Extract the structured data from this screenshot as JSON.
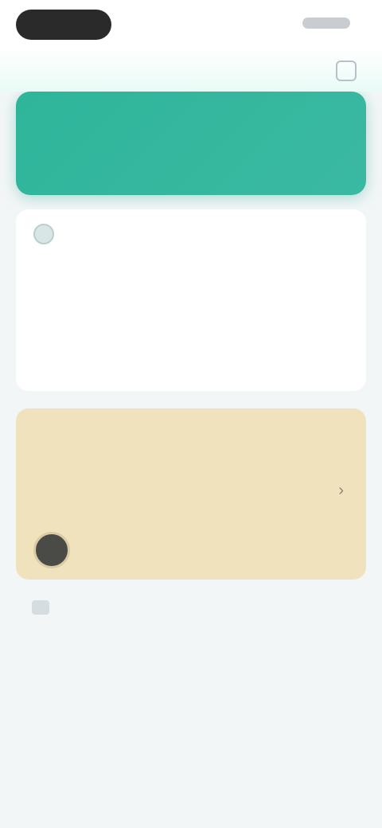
{
  "status_bar": {},
  "nav": {
    "title": "",
    "action_icon": "edit-icon"
  },
  "hero": {
    "label": ""
  },
  "overview": {
    "heading": "",
    "metrics": [
      {
        "label": "",
        "value": "",
        "unit": "",
        "caption": ""
      },
      {
        "label": "",
        "value": "",
        "unit": "",
        "caption": ""
      },
      {
        "label": "",
        "value": "",
        "unit": "",
        "caption": ""
      }
    ],
    "description": ""
  },
  "promo": {
    "tag": "",
    "title": "",
    "body": "",
    "author": "",
    "meta": ""
  },
  "bottom": {
    "label": ""
  },
  "colors": {
    "accent": "#2eb59a",
    "promo_bg": "#f0e2bd",
    "warm_value": "#c7a27e"
  }
}
